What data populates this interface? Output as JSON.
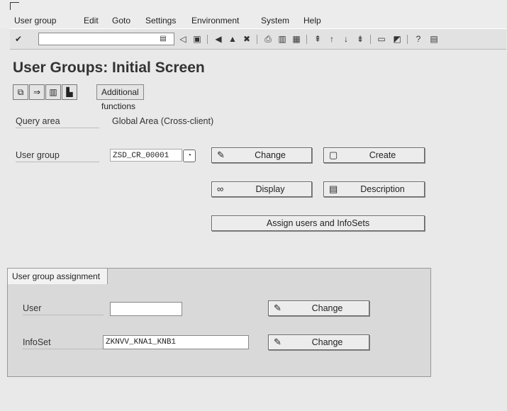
{
  "menu": {
    "items": [
      {
        "label": "User group"
      },
      {
        "label": "Edit"
      },
      {
        "label": "Goto"
      },
      {
        "label": "Settings"
      },
      {
        "label": "Environment"
      },
      {
        "label": "System"
      },
      {
        "label": "Help"
      }
    ]
  },
  "toolbar": {
    "icons": [
      "enter-icon",
      "history-icon",
      "back-icon",
      "save-icon",
      "green-back-icon",
      "exit-icon",
      "cancel-icon",
      "print-icon",
      "find-icon",
      "find-next-icon",
      "first-page-icon",
      "previous-page-icon",
      "next-page-icon",
      "last-page-icon",
      "create-session-icon",
      "shortcut-icon",
      "help-icon",
      "layout-icon"
    ]
  },
  "page": {
    "title": "User Groups: Initial Screen"
  },
  "app_toolbar": {
    "additional_functions": "Additional functions"
  },
  "form": {
    "query_area_label": "Query area",
    "query_area_value": "Global Area (Cross-client)",
    "user_group_label": "User group",
    "user_group_value": "ZSD_CR_00001",
    "change_label": "Change",
    "create_label": "Create",
    "display_label": "Display",
    "description_label": "Description",
    "assign_label": "Assign users and InfoSets"
  },
  "assignment": {
    "tab_label": "User group assignment",
    "user_label": "User",
    "user_value": "",
    "infoset_label": "InfoSet",
    "infoset_value": "ZKNVV_KNA1_KNB1",
    "user_change_label": "Change",
    "infoset_change_label": "Change"
  }
}
